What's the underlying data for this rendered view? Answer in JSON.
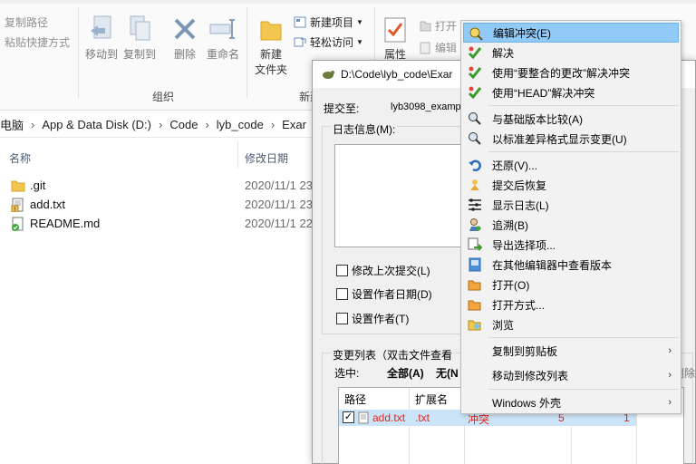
{
  "ribbon": {
    "copy_path": "复制路径",
    "paste_shortcut": "粘贴快捷方式",
    "move_to": "移动到",
    "copy_to": "复制到",
    "delete": "删除",
    "rename": "重命名",
    "new_folder_line1": "新建",
    "new_folder_line2": "文件夹",
    "new_item": "新建项目",
    "easy_access": "轻松访问",
    "group_organize": "组织",
    "group_new": "新建",
    "properties": "属性",
    "open": "打开",
    "edit": "编辑"
  },
  "address": {
    "segments": [
      "电脑",
      "App & Data Disk (D:)",
      "Code",
      "lyb_code",
      "Exar"
    ]
  },
  "files": {
    "col_name": "名称",
    "col_modified": "修改日期",
    "rows": [
      {
        "name": ".git",
        "date": "2020/11/1 23",
        "icon": "folder-icon"
      },
      {
        "name": "add.txt",
        "date": "2020/11/1 23",
        "icon": "conflict-file-icon"
      },
      {
        "name": "README.md",
        "date": "2020/11/1 22",
        "icon": "normal-file-icon"
      }
    ]
  },
  "dialog": {
    "title": "D:\\Code\\lyb_code\\Exar",
    "commit_to_label": "提交至:",
    "commit_to_value": "lyb3098_examp",
    "log_label": "日志信息(M):",
    "amend": "修改上次提交(L)",
    "set_author_date": "设置作者日期(D)",
    "set_author": "设置作者(T)",
    "changes_label": "变更列表（双击文件查看",
    "select_label": "选中:",
    "select_all": "全部(A)",
    "select_none": "无(N",
    "delete_partial": "删除",
    "list_col_path": "路径",
    "list_col_ext": "扩展名",
    "row": {
      "path": "add.txt",
      "ext": ".txt",
      "status": "冲突",
      "num1": "5",
      "num2": "1"
    }
  },
  "menu": {
    "items": [
      {
        "label": "编辑冲突(E)",
        "icon": "edit-conflict-icon",
        "highlight": true
      },
      {
        "label": "解决",
        "icon": "resolve-icon"
      },
      {
        "label": "使用“要整合的更改”解决冲突",
        "icon": "resolve-theirs-icon"
      },
      {
        "label": "使用“HEAD”解决冲突",
        "icon": "resolve-mine-icon"
      },
      {
        "label": "与基础版本比较(A)",
        "icon": "diff-base-icon"
      },
      {
        "label": "以标准差异格式显示变更(U)",
        "icon": "unified-diff-icon"
      },
      {
        "label": "还原(V)...",
        "icon": "revert-icon"
      },
      {
        "label": "提交后恢复",
        "icon": "restore-after-commit-icon"
      },
      {
        "label": "显示日志(L)",
        "icon": "show-log-icon"
      },
      {
        "label": "追溯(B)",
        "icon": "blame-icon"
      },
      {
        "label": "导出选择项...",
        "icon": "export-icon"
      },
      {
        "label": "在其他编辑器中查看版本",
        "icon": "view-other-editor-icon"
      },
      {
        "label": "打开(O)",
        "icon": "open-icon"
      },
      {
        "label": "打开方式...",
        "icon": "open-with-icon"
      },
      {
        "label": "浏览",
        "icon": "browse-icon"
      },
      {
        "label": "复制到剪贴板",
        "icon": "",
        "submenu": true
      },
      {
        "label": "移动到修改列表",
        "icon": "",
        "submenu": true
      },
      {
        "label": "Windows 外壳",
        "icon": "",
        "submenu": true
      }
    ]
  }
}
